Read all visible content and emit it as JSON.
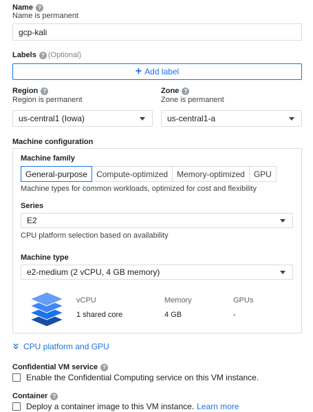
{
  "name": {
    "label": "Name",
    "sub": "Name is permanent",
    "value": "gcp-kali"
  },
  "labels": {
    "label": "Labels",
    "optional": "(Optional)",
    "add_label": "Add label"
  },
  "region": {
    "label": "Region",
    "sub": "Region is permanent",
    "value": "us-central1 (Iowa)"
  },
  "zone": {
    "label": "Zone",
    "sub": "Zone is permanent",
    "value": "us-central1-a"
  },
  "machine_config": {
    "label": "Machine configuration",
    "family_label": "Machine family",
    "tabs": [
      "General-purpose",
      "Compute-optimized",
      "Memory-optimized",
      "GPU"
    ],
    "family_desc": "Machine types for common workloads, optimized for cost and flexibility",
    "series_label": "Series",
    "series_value": "E2",
    "series_desc": "CPU platform selection based on availability",
    "type_label": "Machine type",
    "type_value": "e2-medium (2 vCPU, 4 GB memory)",
    "specs": {
      "vcpu_h": "vCPU",
      "vcpu_v": "1 shared core",
      "mem_h": "Memory",
      "mem_v": "4 GB",
      "gpu_h": "GPUs",
      "gpu_v": "-"
    },
    "icon_colors": [
      "#669df6",
      "#4285f4",
      "#1a73e8",
      "#174ea6"
    ]
  },
  "cpu_platform": {
    "label": "CPU platform and GPU"
  },
  "confidential": {
    "label": "Confidential VM service",
    "checkbox": "Enable the Confidential Computing service on this VM instance."
  },
  "container": {
    "label": "Container",
    "checkbox": "Deploy a container image to this VM instance.",
    "learn_more": "Learn more"
  },
  "colors": {
    "accent": "#1a73e8",
    "border": "#dadce0"
  }
}
